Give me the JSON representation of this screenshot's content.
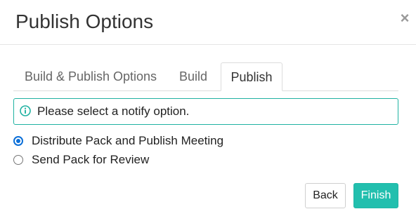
{
  "dialog": {
    "title": "Publish Options",
    "close_symbol": "×"
  },
  "tabs": [
    {
      "label": "Build & Publish Options",
      "active": false
    },
    {
      "label": "Build",
      "active": false
    },
    {
      "label": "Publish",
      "active": true
    }
  ],
  "alert": {
    "icon": "info-circle-icon",
    "message": "Please select a notify option.",
    "color": "#20b2a2"
  },
  "options": [
    {
      "label": "Distribute Pack and Publish Meeting",
      "checked": true
    },
    {
      "label": "Send Pack for Review",
      "checked": false
    }
  ],
  "buttons": {
    "back": "Back",
    "finish": "Finish"
  },
  "colors": {
    "accent": "#22bfae",
    "radio_selected": "#0b6fd8"
  }
}
